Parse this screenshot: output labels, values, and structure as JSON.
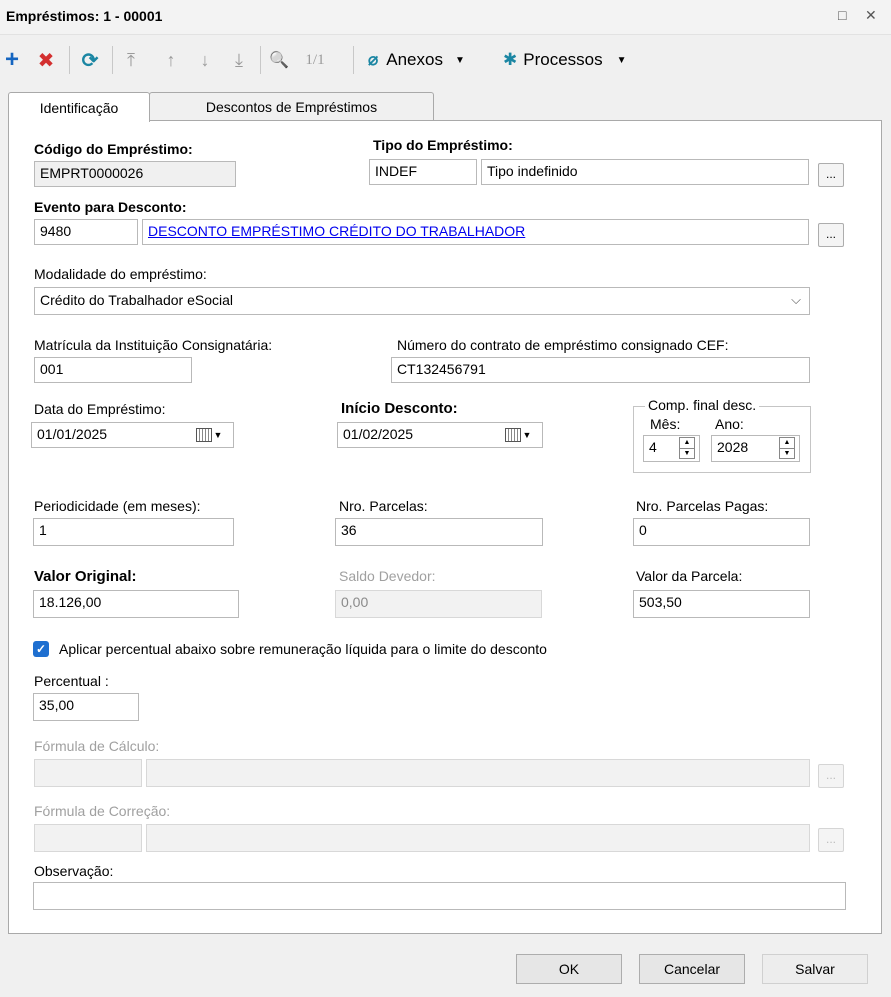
{
  "window": {
    "title": "Empréstimos: 1 - 00001",
    "maximize": "□",
    "close": "✕"
  },
  "toolbar": {
    "add": "+",
    "delete": "✖",
    "refresh": "⟳",
    "first": "⤒",
    "prev": "↑",
    "next": "↓",
    "last": "⤓",
    "search": "🔍",
    "page": "1/1",
    "attachments_label": "Anexos",
    "processes_label": "Processos"
  },
  "tabs": [
    {
      "label": "Identificação"
    },
    {
      "label": "Descontos de Empréstimos"
    }
  ],
  "form": {
    "codigo": {
      "label": "Código do Empréstimo:",
      "value": "EMPRT0000026"
    },
    "tipo": {
      "label": "Tipo do Empréstimo:",
      "code": "INDEF",
      "desc": "Tipo indefinido"
    },
    "evento": {
      "label": "Evento para Desconto:",
      "code": "9480",
      "desc": "DESCONTO EMPRÉSTIMO CRÉDITO DO TRABALHADOR"
    },
    "modalidade": {
      "label": "Modalidade do empréstimo:",
      "value": "Crédito do Trabalhador eSocial"
    },
    "matricula": {
      "label": "Matrícula da Instituição Consignatária:",
      "value": "001"
    },
    "contrato": {
      "label": "Número do contrato de empréstimo consignado CEF:",
      "value": "CT132456791"
    },
    "data_emprestimo": {
      "label": "Data do Empréstimo:",
      "value": "01/01/2025"
    },
    "inicio_desconto": {
      "label": "Início Desconto:",
      "value": "01/02/2025"
    },
    "comp_final": {
      "legend": "Comp. final desc.",
      "mes_label": "Mês:",
      "mes": "4",
      "ano_label": "Ano:",
      "ano": "2028"
    },
    "periodicidade": {
      "label": "Periodicidade (em meses):",
      "value": "1"
    },
    "nro_parcelas": {
      "label": "Nro. Parcelas:",
      "value": "36"
    },
    "parcelas_pagas": {
      "label": "Nro. Parcelas Pagas:",
      "value": "0"
    },
    "valor_original": {
      "label": "Valor Original:",
      "value": "18.126,00"
    },
    "saldo_devedor": {
      "label": "Saldo Devedor:",
      "value": "0,00"
    },
    "valor_parcela": {
      "label": "Valor da Parcela:",
      "value": "503,50"
    },
    "aplicar_percentual": {
      "label": "Aplicar percentual abaixo sobre remuneração líquida para o limite do desconto",
      "checked": true
    },
    "percentual": {
      "label": "Percentual :",
      "value": "35,00"
    },
    "formula_calculo": {
      "label": "Fórmula de Cálculo:"
    },
    "formula_correcao": {
      "label": "Fórmula de Correção:"
    },
    "observacao": {
      "label": "Observação:",
      "value": ""
    },
    "lookup_button": "..."
  },
  "footer": {
    "ok": "OK",
    "cancel": "Cancelar",
    "save": "Salvar"
  },
  "colors": {
    "accent_blue": "#1565c0",
    "delete_red": "#d32f2f",
    "refresh_teal": "#1b86a3",
    "link": "#0000ee",
    "checkbox": "#1e6fd0"
  }
}
